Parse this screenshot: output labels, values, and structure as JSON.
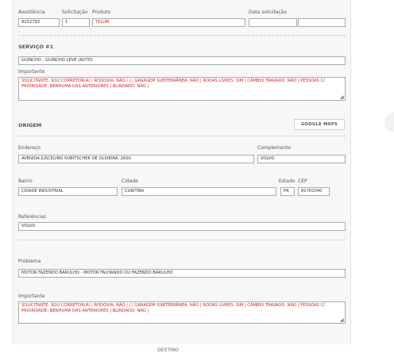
{
  "header": {
    "assistencia": {
      "label": "Assistência",
      "value": "8152793"
    },
    "solicitacao": {
      "label": "Solicitação",
      "value": "1"
    },
    "produto": {
      "label": "Produto",
      "value": "YELUM"
    },
    "data_solicitacao": {
      "label": "Data solicitação",
      "date": "",
      "time": ""
    }
  },
  "servico": {
    "title": "SERVIÇO #1",
    "service_value": "GUINCHO - GUINCHO LEVE (AUTO)",
    "importante_label": "Importante",
    "importante_text": "SOLICITANTE: SOU CORRETOR(A) | RODOVIA: NÃO | | | GARAGEM SUBTERRÂNEA: NÃO | RODAS LIVRES: SIM | CÂMBIO TRAVADO: NÃO | PESSOAS C/ PRIORIDADE: NENHUMA DAS ANTERIORES | BLINDADO: NÃO |"
  },
  "origem": {
    "title": "ORIGEM",
    "google_maps_label": "GOOGLE MAPS",
    "endereco": {
      "label": "Endereço",
      "value": "AVENIDA JUSCELINO KUBITSCHEK DE OLIVEIRA, 2600"
    },
    "complemento": {
      "label": "Complemento",
      "value": "VOLVO"
    },
    "bairro": {
      "label": "Bairro",
      "value": "CIDADE INDUSTRIAL"
    },
    "cidade": {
      "label": "Cidade",
      "value": "CURITIBA"
    },
    "estado": {
      "label": "Estado",
      "value": "PR"
    },
    "cep": {
      "label": "CEP",
      "value": "81702040"
    },
    "referencias": {
      "label": "Referências",
      "value": "VOLVO"
    }
  },
  "problema": {
    "label": "Problema",
    "value": "MOTOR FAZENDO BARULHO - MOTOR FALHANDO OU FAZENDO BARULHO",
    "importante_label": "Importante",
    "importante_text": "SOLICITANTE: SOU CORRETOR(A) | RODOVIA: NÃO | | | GARAGEM SUBTERRÂNEA: NÃO | RODAS LIVRES: SIM | CÂMBIO TRAVADO: NÃO | PESSOAS C/ PRIORIDADE: NENHUMA DAS ANTERIORES | BLINDADO: NÃO |"
  },
  "footer": {
    "text": "DESTINO"
  },
  "colors": {
    "accent_red": "#d21e1e",
    "panel_bg": "#f7f7f7",
    "border": "#a9a9a9"
  },
  "icons": {
    "resize": "resize-grip-icon"
  }
}
